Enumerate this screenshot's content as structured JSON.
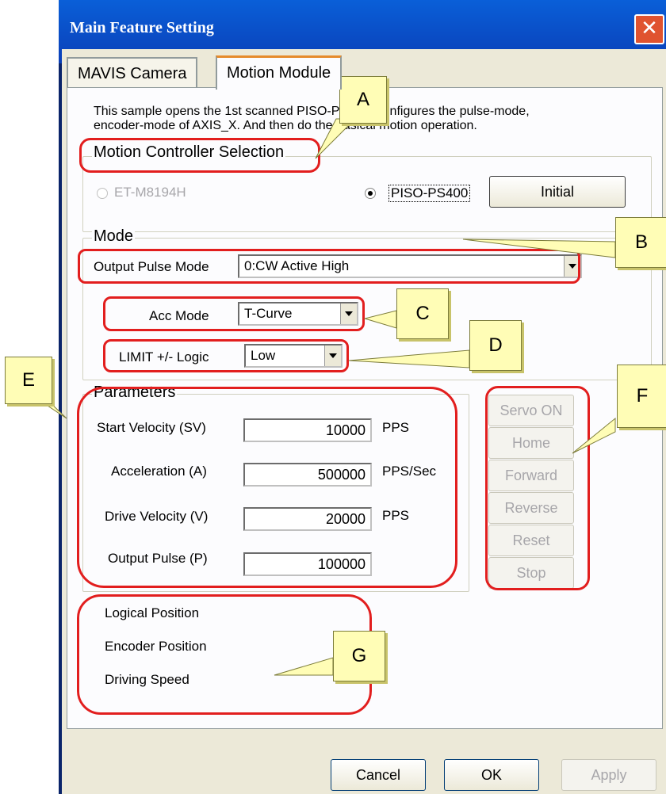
{
  "window": {
    "title": "Main Feature Setting",
    "close_icon": "close-icon"
  },
  "tabs": [
    {
      "label": "MAVIS Camera"
    },
    {
      "label": "Motion Module"
    }
  ],
  "description": [
    "This sample opens the 1st scanned PISO-PS400, configures the pulse-mode,",
    "encoder-mode of AXIS_X. And then do the basical motion operation."
  ],
  "controller": {
    "group_label": "Motion Controller Selection",
    "option1": "ET-M8194H",
    "option2": "PISO-PS400",
    "selected": "PISO-PS400",
    "initial_button": "Initial"
  },
  "mode": {
    "group_label": "Mode",
    "output_pulse_label": "Output Pulse Mode",
    "output_pulse_value": "0:CW Active High",
    "acc_label": "Acc Mode",
    "acc_value": "T-Curve",
    "limit_label": "LIMIT +/- Logic",
    "limit_value": "Low"
  },
  "parameters": {
    "group_label": "Parameters",
    "rows": [
      {
        "label": "Start Velocity (SV)",
        "value": "10000",
        "unit": "PPS"
      },
      {
        "label": "Acceleration (A)",
        "value": "500000",
        "unit": "PPS/Sec"
      },
      {
        "label": "Drive Velocity (V)",
        "value": "20000",
        "unit": "PPS"
      },
      {
        "label": "Output Pulse (P)",
        "value": "100000",
        "unit": ""
      }
    ]
  },
  "actions": [
    "Servo ON",
    "Home",
    "Forward",
    "Reverse",
    "Reset",
    "Stop"
  ],
  "status": [
    "Logical Position",
    "Encoder Position",
    "Driving Speed"
  ],
  "footer": {
    "cancel": "Cancel",
    "ok": "OK",
    "apply": "Apply"
  },
  "callouts": [
    "A",
    "B",
    "C",
    "D",
    "E",
    "F",
    "G"
  ],
  "colors": {
    "title_bar": "#0a4fc8",
    "highlight": "#e21e1e",
    "callout": "#fffdb6",
    "tab_accent": "#e68b2c"
  }
}
